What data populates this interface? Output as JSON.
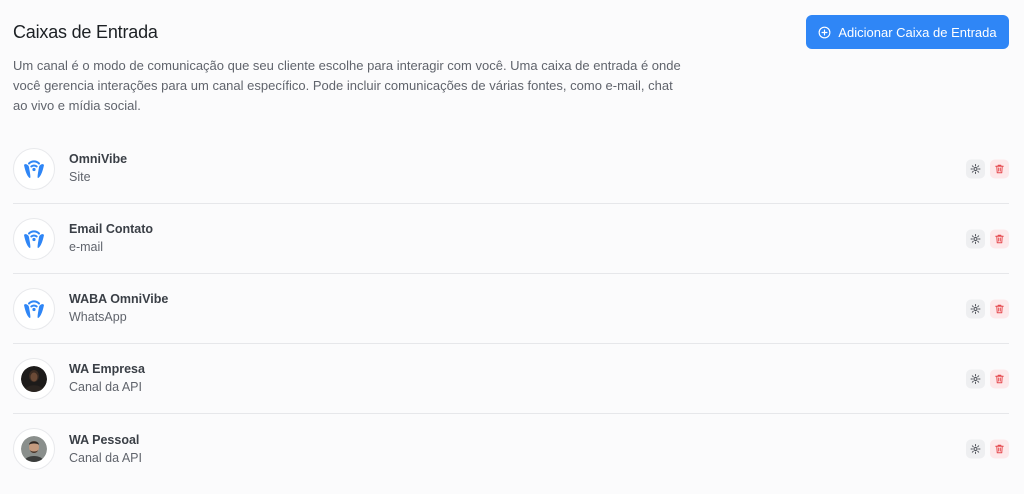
{
  "page": {
    "title": "Caixas de Entrada",
    "description": "Um canal é o modo de comunicação que seu cliente escolhe para interagir com você. Uma caixa de entrada é onde você gerencia interações para um canal específico. Pode incluir comunicações de várias fontes, como e-mail, chat ao vivo e mídia social.",
    "add_button_label": "Adicionar Caixa de Entrada"
  },
  "inboxes": [
    {
      "name": "OmniVibe",
      "type": "Site",
      "avatar": "wifi-brand-icon"
    },
    {
      "name": "Email Contato",
      "type": "e-mail",
      "avatar": "wifi-brand-icon"
    },
    {
      "name": "WABA OmniVibe",
      "type": "WhatsApp",
      "avatar": "wifi-brand-icon"
    },
    {
      "name": "WA Empresa",
      "type": "Canal da API",
      "avatar": "profile-photo-dark"
    },
    {
      "name": "WA Pessoal",
      "type": "Canal da API",
      "avatar": "profile-photo-person"
    }
  ],
  "colors": {
    "primary": "#2f86f6",
    "brand_icon": "#2f86f6",
    "delete": "#e5484d",
    "settings": "#60646c"
  }
}
